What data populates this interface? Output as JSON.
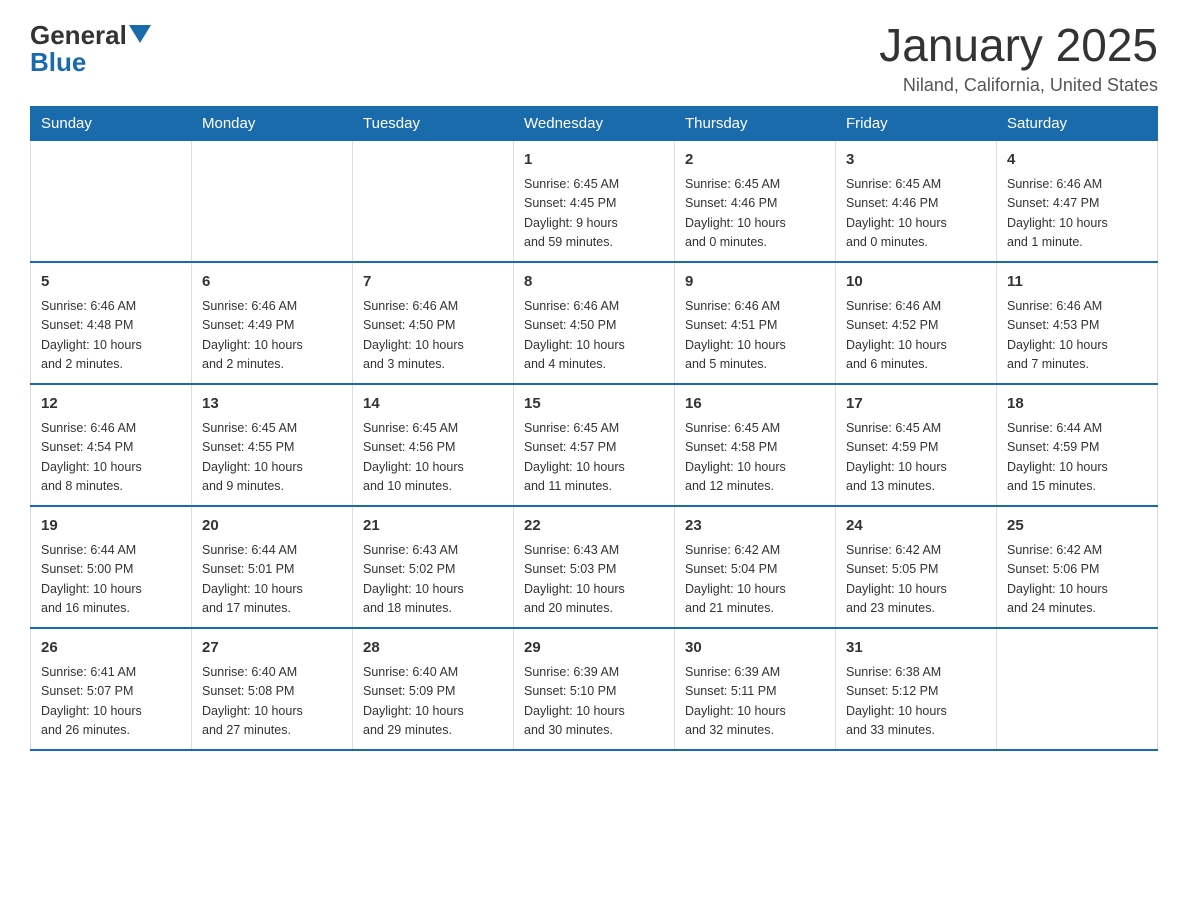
{
  "logo": {
    "general": "General",
    "blue": "Blue"
  },
  "title": "January 2025",
  "location": "Niland, California, United States",
  "days_of_week": [
    "Sunday",
    "Monday",
    "Tuesday",
    "Wednesday",
    "Thursday",
    "Friday",
    "Saturday"
  ],
  "weeks": [
    [
      {
        "day": "",
        "info": ""
      },
      {
        "day": "",
        "info": ""
      },
      {
        "day": "",
        "info": ""
      },
      {
        "day": "1",
        "info": "Sunrise: 6:45 AM\nSunset: 4:45 PM\nDaylight: 9 hours\nand 59 minutes."
      },
      {
        "day": "2",
        "info": "Sunrise: 6:45 AM\nSunset: 4:46 PM\nDaylight: 10 hours\nand 0 minutes."
      },
      {
        "day": "3",
        "info": "Sunrise: 6:45 AM\nSunset: 4:46 PM\nDaylight: 10 hours\nand 0 minutes."
      },
      {
        "day": "4",
        "info": "Sunrise: 6:46 AM\nSunset: 4:47 PM\nDaylight: 10 hours\nand 1 minute."
      }
    ],
    [
      {
        "day": "5",
        "info": "Sunrise: 6:46 AM\nSunset: 4:48 PM\nDaylight: 10 hours\nand 2 minutes."
      },
      {
        "day": "6",
        "info": "Sunrise: 6:46 AM\nSunset: 4:49 PM\nDaylight: 10 hours\nand 2 minutes."
      },
      {
        "day": "7",
        "info": "Sunrise: 6:46 AM\nSunset: 4:50 PM\nDaylight: 10 hours\nand 3 minutes."
      },
      {
        "day": "8",
        "info": "Sunrise: 6:46 AM\nSunset: 4:50 PM\nDaylight: 10 hours\nand 4 minutes."
      },
      {
        "day": "9",
        "info": "Sunrise: 6:46 AM\nSunset: 4:51 PM\nDaylight: 10 hours\nand 5 minutes."
      },
      {
        "day": "10",
        "info": "Sunrise: 6:46 AM\nSunset: 4:52 PM\nDaylight: 10 hours\nand 6 minutes."
      },
      {
        "day": "11",
        "info": "Sunrise: 6:46 AM\nSunset: 4:53 PM\nDaylight: 10 hours\nand 7 minutes."
      }
    ],
    [
      {
        "day": "12",
        "info": "Sunrise: 6:46 AM\nSunset: 4:54 PM\nDaylight: 10 hours\nand 8 minutes."
      },
      {
        "day": "13",
        "info": "Sunrise: 6:45 AM\nSunset: 4:55 PM\nDaylight: 10 hours\nand 9 minutes."
      },
      {
        "day": "14",
        "info": "Sunrise: 6:45 AM\nSunset: 4:56 PM\nDaylight: 10 hours\nand 10 minutes."
      },
      {
        "day": "15",
        "info": "Sunrise: 6:45 AM\nSunset: 4:57 PM\nDaylight: 10 hours\nand 11 minutes."
      },
      {
        "day": "16",
        "info": "Sunrise: 6:45 AM\nSunset: 4:58 PM\nDaylight: 10 hours\nand 12 minutes."
      },
      {
        "day": "17",
        "info": "Sunrise: 6:45 AM\nSunset: 4:59 PM\nDaylight: 10 hours\nand 13 minutes."
      },
      {
        "day": "18",
        "info": "Sunrise: 6:44 AM\nSunset: 4:59 PM\nDaylight: 10 hours\nand 15 minutes."
      }
    ],
    [
      {
        "day": "19",
        "info": "Sunrise: 6:44 AM\nSunset: 5:00 PM\nDaylight: 10 hours\nand 16 minutes."
      },
      {
        "day": "20",
        "info": "Sunrise: 6:44 AM\nSunset: 5:01 PM\nDaylight: 10 hours\nand 17 minutes."
      },
      {
        "day": "21",
        "info": "Sunrise: 6:43 AM\nSunset: 5:02 PM\nDaylight: 10 hours\nand 18 minutes."
      },
      {
        "day": "22",
        "info": "Sunrise: 6:43 AM\nSunset: 5:03 PM\nDaylight: 10 hours\nand 20 minutes."
      },
      {
        "day": "23",
        "info": "Sunrise: 6:42 AM\nSunset: 5:04 PM\nDaylight: 10 hours\nand 21 minutes."
      },
      {
        "day": "24",
        "info": "Sunrise: 6:42 AM\nSunset: 5:05 PM\nDaylight: 10 hours\nand 23 minutes."
      },
      {
        "day": "25",
        "info": "Sunrise: 6:42 AM\nSunset: 5:06 PM\nDaylight: 10 hours\nand 24 minutes."
      }
    ],
    [
      {
        "day": "26",
        "info": "Sunrise: 6:41 AM\nSunset: 5:07 PM\nDaylight: 10 hours\nand 26 minutes."
      },
      {
        "day": "27",
        "info": "Sunrise: 6:40 AM\nSunset: 5:08 PM\nDaylight: 10 hours\nand 27 minutes."
      },
      {
        "day": "28",
        "info": "Sunrise: 6:40 AM\nSunset: 5:09 PM\nDaylight: 10 hours\nand 29 minutes."
      },
      {
        "day": "29",
        "info": "Sunrise: 6:39 AM\nSunset: 5:10 PM\nDaylight: 10 hours\nand 30 minutes."
      },
      {
        "day": "30",
        "info": "Sunrise: 6:39 AM\nSunset: 5:11 PM\nDaylight: 10 hours\nand 32 minutes."
      },
      {
        "day": "31",
        "info": "Sunrise: 6:38 AM\nSunset: 5:12 PM\nDaylight: 10 hours\nand 33 minutes."
      },
      {
        "day": "",
        "info": ""
      }
    ]
  ]
}
